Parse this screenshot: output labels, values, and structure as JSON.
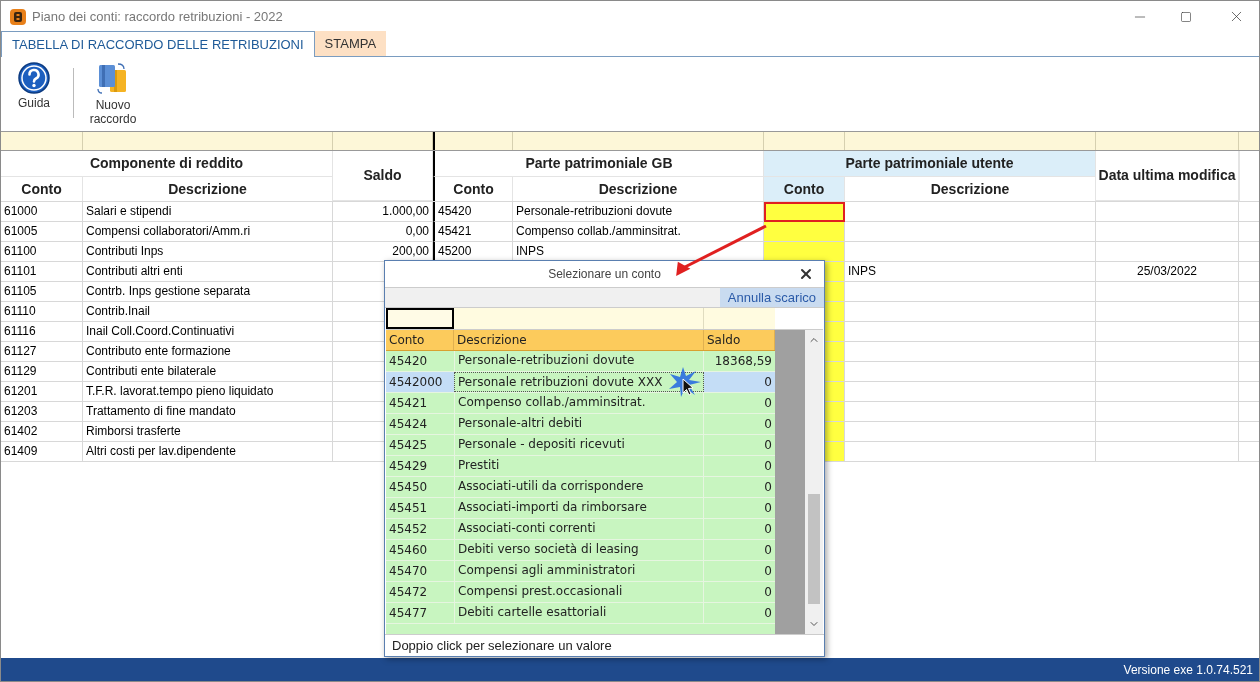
{
  "window": {
    "title": "Piano dei conti: raccordo retribuzioni - 2022"
  },
  "tabs": [
    {
      "label": "TABELLA DI RACCORDO DELLE RETRIBUZIONI",
      "selected": true
    },
    {
      "label": "STAMPA",
      "selected": false
    }
  ],
  "toolbar": [
    {
      "label": "Guida",
      "kind": "help"
    },
    {
      "label": "Nuovo raccordo",
      "kind": "new"
    }
  ],
  "table": {
    "header_groups": [
      {
        "label": "Componente di reddito",
        "columns": [
          "Conto",
          "Descrizione"
        ]
      },
      {
        "label": "Saldo"
      },
      {
        "label": "Parte patrimoniale GB",
        "columns": [
          "Conto",
          "Descrizione"
        ]
      },
      {
        "label": "Parte patrimoniale utente",
        "columns": [
          "Conto",
          "Descrizione"
        ]
      },
      {
        "label": "Data ultima modifica"
      }
    ],
    "rows": [
      {
        "conto": "61000",
        "descrizione": "Salari e stipendi",
        "saldo": "1.000,00",
        "gb_conto": "45420",
        "gb_descrizione": "Personale-retribuzioni dovute",
        "selected": true
      },
      {
        "conto": "61005",
        "descrizione": "Compensi collaboratori/Amm.ri",
        "saldo": "0,00",
        "gb_conto": "45421",
        "gb_descrizione": "Compenso collab./amminsitrat.",
        "selected": false
      },
      {
        "conto": "61100",
        "descrizione": "Contributi Inps",
        "saldo": "200,00",
        "gb_conto": "45200",
        "gb_descrizione": "INPS",
        "selected": false
      },
      {
        "conto": "61101",
        "descrizione": "Contributi altri enti",
        "utente_descrizione": "INPS",
        "data": "25/03/2022",
        "selected": false
      },
      {
        "conto": "61105",
        "descrizione": "Contrb. Inps gestione separata",
        "selected": false
      },
      {
        "conto": "61110",
        "descrizione": "Contrib.Inail",
        "selected": false
      },
      {
        "conto": "61116",
        "descrizione": "Inail Coll.Coord.Continuativi",
        "selected": false
      },
      {
        "conto": "61127",
        "descrizione": "Contributo ente formazione",
        "selected": false
      },
      {
        "conto": "61129",
        "descrizione": "Contributi ente bilaterale",
        "selected": false
      },
      {
        "conto": "61201",
        "descrizione": "T.F.R. lavorat.tempo pieno liquidato",
        "selected": false
      },
      {
        "conto": "61203",
        "descrizione": "Trattamento di fine mandato",
        "selected": false
      },
      {
        "conto": "61402",
        "descrizione": "Rimborsi trasferte",
        "selected": false
      },
      {
        "conto": "61409",
        "descrizione": "Altri costi per lav.dipendente",
        "selected": false
      }
    ]
  },
  "dialog": {
    "title": "Selezionare un conto",
    "action": "Annulla scarico",
    "columns": [
      "Conto",
      "Descrizione",
      "Saldo"
    ],
    "rows": [
      {
        "conto": "45420",
        "descrizione": "Personale-retribuzioni dovute",
        "saldo": "18368,59",
        "selected": false
      },
      {
        "conto": "4542000",
        "descrizione": "Personale retribuzioni dovute XXX",
        "saldo": "0",
        "selected": true
      },
      {
        "conto": "45421",
        "descrizione": "Compenso collab./amminsitrat.",
        "saldo": "0",
        "selected": false
      },
      {
        "conto": "45424",
        "descrizione": "Personale-altri debiti",
        "saldo": "0",
        "selected": false
      },
      {
        "conto": "45425",
        "descrizione": "Personale - depositi ricevuti",
        "saldo": "0",
        "selected": false
      },
      {
        "conto": "45429",
        "descrizione": "Prestiti",
        "saldo": "0",
        "selected": false
      },
      {
        "conto": "45450",
        "descrizione": "Associati-utili da corrispondere",
        "saldo": "0",
        "selected": false
      },
      {
        "conto": "45451",
        "descrizione": "Associati-importi da rimborsare",
        "saldo": "0",
        "selected": false
      },
      {
        "conto": "45452",
        "descrizione": "Associati-conti correnti",
        "saldo": "0",
        "selected": false
      },
      {
        "conto": "45460",
        "descrizione": "Debiti verso società di leasing",
        "saldo": "0",
        "selected": false
      },
      {
        "conto": "45470",
        "descrizione": "Compensi agli amministratori",
        "saldo": "0",
        "selected": false
      },
      {
        "conto": "45472",
        "descrizione": "Compensi prest.occasionali",
        "saldo": "0",
        "selected": false
      },
      {
        "conto": "45477",
        "descrizione": "Debiti cartelle esattoriali",
        "saldo": "0",
        "selected": false
      }
    ],
    "hint": "Doppio click per selezionare un valore"
  },
  "status_bar": {
    "version": "Versione exe 1.0.74.521"
  }
}
